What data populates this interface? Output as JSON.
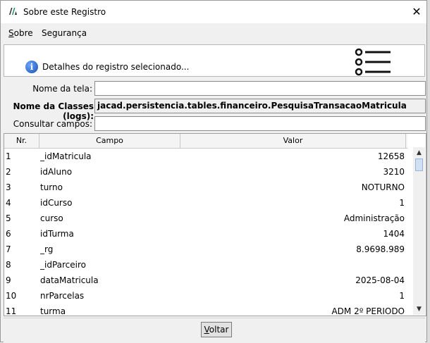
{
  "window": {
    "title": "Sobre este Registro",
    "close_glyph": "✕",
    "app_icon": "app-logo-icon"
  },
  "menu": [
    {
      "label": "Sobre"
    },
    {
      "label": "Segurança"
    }
  ],
  "info": {
    "text": "Detalhes do registro selecionado...",
    "icon": "info-icon",
    "menu_icon": "list-menu-icon"
  },
  "form": {
    "nome_tela_label": "Nome da tela:",
    "nome_tela_value": "",
    "classe_label": "Nome da Classes (logs):",
    "classe_value": "jacad.persistencia.tables.financeiro.PesquisaTransacaoMatricula",
    "consultar_label": "Consultar campos:",
    "consultar_value": ""
  },
  "table": {
    "headers": {
      "nr": "Nr.",
      "campo": "Campo",
      "valor": "Valor"
    },
    "rows": [
      {
        "nr": "1",
        "campo": "_idMatricula",
        "valor": "12658"
      },
      {
        "nr": "2",
        "campo": "idAluno",
        "valor": "3210"
      },
      {
        "nr": "3",
        "campo": "turno",
        "valor": "NOTURNO"
      },
      {
        "nr": "4",
        "campo": "idCurso",
        "valor": "1"
      },
      {
        "nr": "5",
        "campo": "curso",
        "valor": "Administração"
      },
      {
        "nr": "6",
        "campo": "idTurma",
        "valor": "1404"
      },
      {
        "nr": "7",
        "campo": "_rg",
        "valor": "8.9698.989"
      },
      {
        "nr": "8",
        "campo": "_idParceiro",
        "valor": ""
      },
      {
        "nr": "9",
        "campo": "dataMatricula",
        "valor": "2025-08-04"
      },
      {
        "nr": "10",
        "campo": "nrParcelas",
        "valor": "1"
      },
      {
        "nr": "11",
        "campo": "turma",
        "valor": "ADM 2º PERIODO"
      }
    ]
  },
  "footer": {
    "button_label": "Voltar"
  },
  "colors": {
    "titlebar": "#ffffff",
    "window_bg": "#f0f0f0",
    "info_blue": "#1a4fb0"
  }
}
